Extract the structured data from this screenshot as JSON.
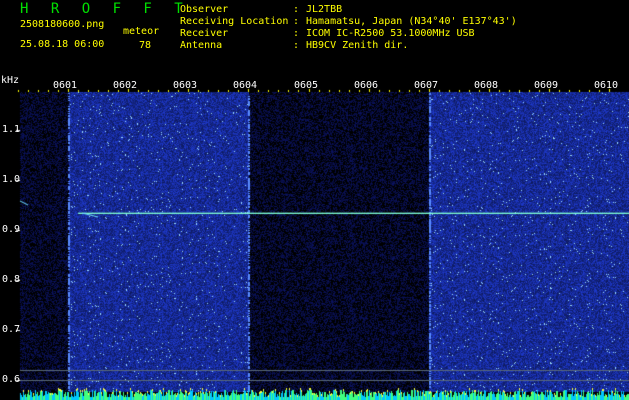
{
  "header": {
    "brand": "H R O F F T",
    "filename": "2508180600.png",
    "timestamp": "25.08.18 06:00",
    "meteor_label": "meteor",
    "meteor_count": "78"
  },
  "station_info": [
    {
      "key": "Observer",
      "value": "JL2TBB"
    },
    {
      "key": "Receiving Location",
      "value": "Hamamatsu, Japan (N34°40' E137°43')"
    },
    {
      "key": "Receiver",
      "value": "ICOM IC-R2500 53.1000MHz USB"
    },
    {
      "key": "Antenna",
      "value": "HB9CV Zenith dir."
    }
  ],
  "colon": ":",
  "chart_data": {
    "type": "heatmap",
    "title": "",
    "ylabel": "kHz",
    "xlabel": "",
    "x_ticks": [
      "0601",
      "0602",
      "0603",
      "0604",
      "0605",
      "0606",
      "0607",
      "0608",
      "0609",
      "0610"
    ],
    "y_ticks": [
      "1.1",
      "1.0",
      "0.9",
      "0.8",
      "0.7",
      "0.6"
    ],
    "ylim": [
      0.58,
      1.17
    ],
    "carrier_khz": 0.933,
    "quiet_intervals": [
      [
        "0600",
        "0600.8"
      ],
      [
        "0604",
        "0607"
      ]
    ],
    "colors": {
      "background": "#000000",
      "noise": "#1a2a9c",
      "carrier": "#7fffd4",
      "tick": "#ffff00",
      "text_white": "#ffffff",
      "brand_green": "#00e000"
    }
  }
}
